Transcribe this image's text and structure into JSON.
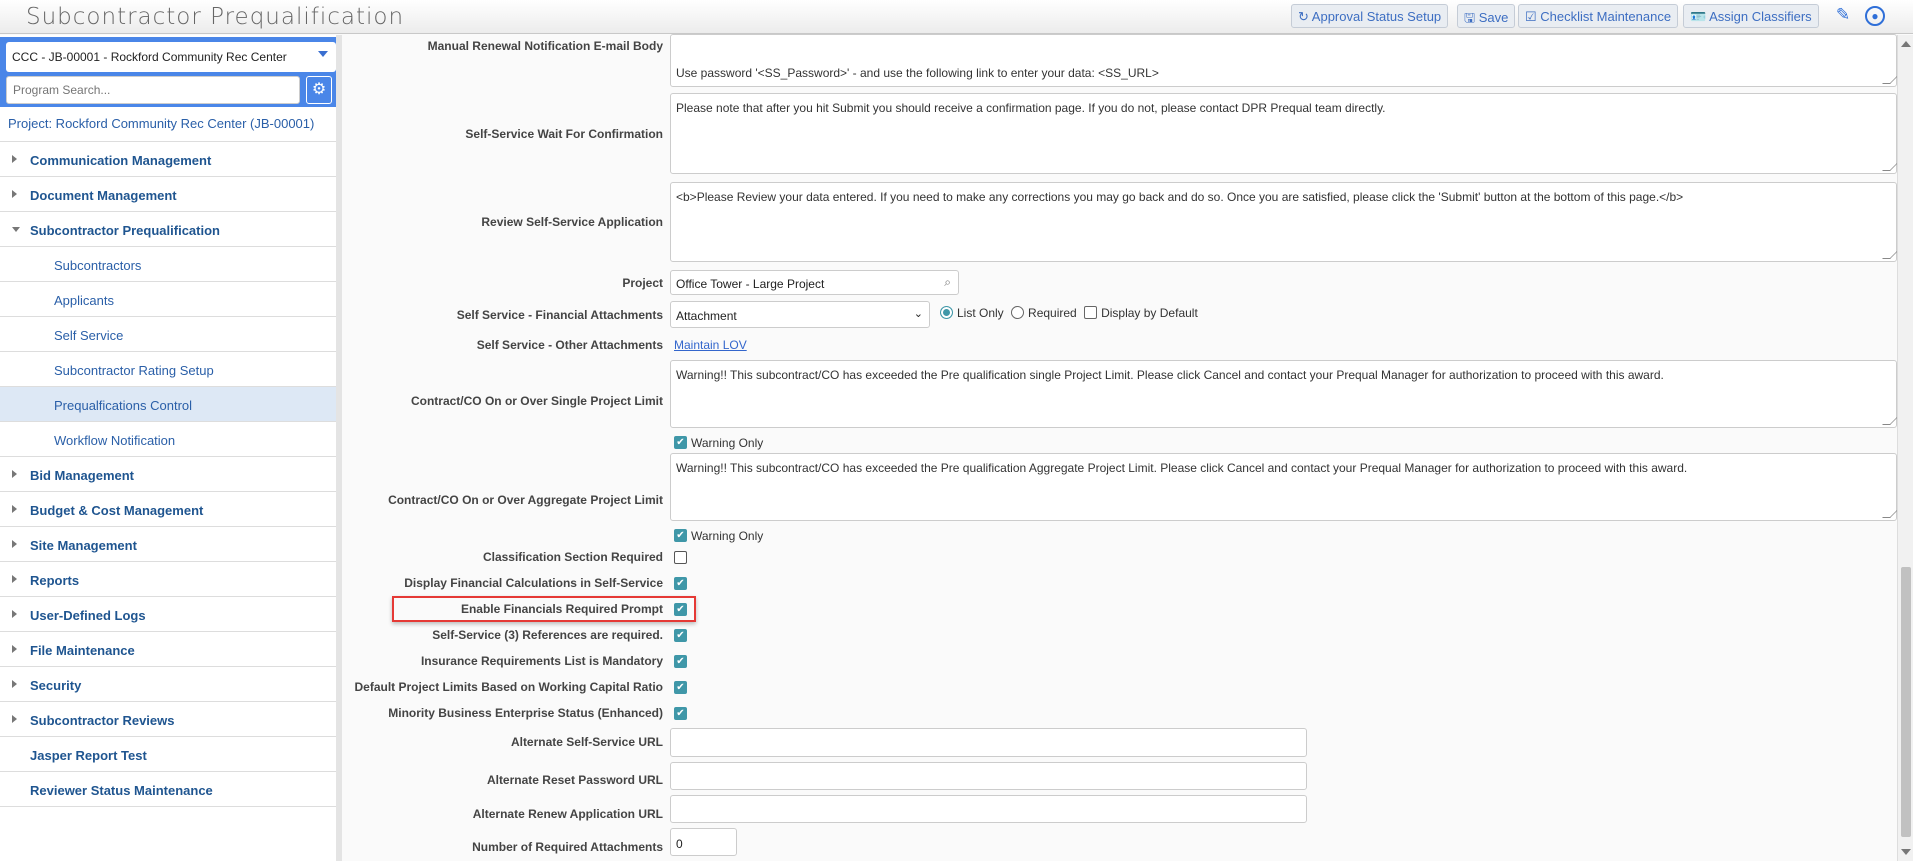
{
  "header": {
    "title": "Subcontractor Prequalification",
    "buttons": {
      "approval": "Approval Status Setup",
      "save": "Save",
      "checklist": "Checklist Maintenance",
      "classifiers": "Assign Classifiers"
    }
  },
  "sidebar": {
    "project_select": "CCC - JB-00001 - Rockford Community Rec Center",
    "search_placeholder": "Program Search...",
    "project_link": "Project: Rockford Community Rec Center (JB-00001)",
    "items": [
      "Communication Management",
      "Document Management",
      "Subcontractor Prequalification",
      "Bid Management",
      "Budget & Cost Management",
      "Site Management",
      "Reports",
      "User-Defined Logs",
      "File Maintenance",
      "Security",
      "Subcontractor Reviews",
      "Jasper Report Test",
      "Reviewer Status Maintenance"
    ],
    "subitems": [
      "Subcontractors",
      "Applicants",
      "Self Service",
      "Subcontractor Rating Setup",
      "Prequalfications Control",
      "Workflow Notification"
    ]
  },
  "form": {
    "manual_renewal": {
      "label": "Manual Renewal Notification E-mail Body",
      "value": "Use password '<SS_Password>' - and use the following link to enter your data: <SS_URL>"
    },
    "wait_confirm": {
      "label": "Self-Service Wait For Confirmation",
      "value": "Please note that after you hit Submit you should receive a confirmation page.  If you do not, please contact DPR Prequal team directly."
    },
    "review": {
      "label": "Review Self-Service Application",
      "value": "<b>Please Review your data entered.  If you need to make any corrections you may go back and do so.  Once you are satisfied, please click the 'Submit' button at the bottom of this page.</b>"
    },
    "project": {
      "label": "Project",
      "value": "Office Tower - Large Project"
    },
    "fin_attach": {
      "label": "Self Service - Financial Attachments",
      "value": "Attachment",
      "list_only": "List Only",
      "required": "Required",
      "display_default": "Display by Default"
    },
    "other_attach": {
      "label": "Self Service - Other Attachments",
      "link": "Maintain LOV"
    },
    "single_limit": {
      "label": "Contract/CO On or Over Single Project Limit",
      "value": "Warning!! This subcontract/CO has exceeded the Pre qualification single Project Limit. Please click Cancel and contact your Prequal Manager for authorization to proceed with this award.",
      "warning": "Warning Only"
    },
    "aggregate_limit": {
      "label": "Contract/CO On or Over Aggregate Project Limit",
      "value": "Warning!! This subcontract/CO has exceeded the Pre qualification Aggregate Project Limit. Please click Cancel and contact your Prequal Manager for authorization to proceed with this award.",
      "warning": "Warning Only"
    },
    "checks": [
      {
        "label": "Classification Section Required",
        "checked": false
      },
      {
        "label": "Display Financial Calculations in Self-Service",
        "checked": true
      },
      {
        "label": "Enable Financials Required Prompt",
        "checked": true
      },
      {
        "label": "Self-Service (3) References are required.",
        "checked": true
      },
      {
        "label": "Insurance Requirements List is Mandatory",
        "checked": true
      },
      {
        "label": "Default Project Limits Based on Working Capital Ratio",
        "checked": true
      },
      {
        "label": "Minority Business Enterprise Status (Enhanced)",
        "checked": true
      }
    ],
    "alt_ss_url": {
      "label": "Alternate Self-Service URL",
      "value": ""
    },
    "alt_reset_url": {
      "label": "Alternate Reset Password URL",
      "value": ""
    },
    "alt_renew_url": {
      "label": "Alternate Renew Application URL",
      "value": ""
    },
    "num_attach": {
      "label": "Number of Required Attachments",
      "value": "0"
    }
  }
}
